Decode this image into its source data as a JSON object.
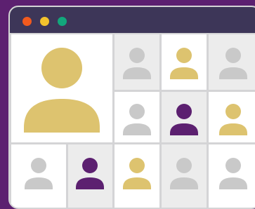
{
  "window": {
    "traffic_lights": [
      {
        "name": "close-dot",
        "color": "#f25a1e"
      },
      {
        "name": "minimize-dot",
        "color": "#f3c22d"
      },
      {
        "name": "zoom-dot",
        "color": "#12a77c"
      }
    ]
  },
  "participants": [
    {
      "id": "main-speaker",
      "icon": "person-icon",
      "color": "#ddc36f",
      "background": "#ffffff"
    },
    {
      "id": "p1",
      "icon": "person-icon",
      "color": "#c9c9c9",
      "background": "#ececec"
    },
    {
      "id": "p2",
      "icon": "person-icon",
      "color": "#ddc36f",
      "background": "#ffffff"
    },
    {
      "id": "p3",
      "icon": "person-icon",
      "color": "#c9c9c9",
      "background": "#ececec"
    },
    {
      "id": "p4",
      "icon": "person-icon",
      "color": "#c9c9c9",
      "background": "#ffffff"
    },
    {
      "id": "p5",
      "icon": "person-icon",
      "color": "#5c2070",
      "background": "#ececec"
    },
    {
      "id": "p6",
      "icon": "person-icon",
      "color": "#ddc36f",
      "background": "#ffffff"
    },
    {
      "id": "p7",
      "icon": "person-icon",
      "color": "#c9c9c9",
      "background": "#ffffff"
    },
    {
      "id": "p8",
      "icon": "person-icon",
      "color": "#5c2070",
      "background": "#ececec"
    },
    {
      "id": "p9",
      "icon": "person-icon",
      "color": "#ddc36f",
      "background": "#ffffff"
    },
    {
      "id": "p10",
      "icon": "person-icon",
      "color": "#c9c9c9",
      "background": "#ececec"
    },
    {
      "id": "p11",
      "icon": "person-icon",
      "color": "#c9c9c9",
      "background": "#ffffff"
    }
  ]
}
